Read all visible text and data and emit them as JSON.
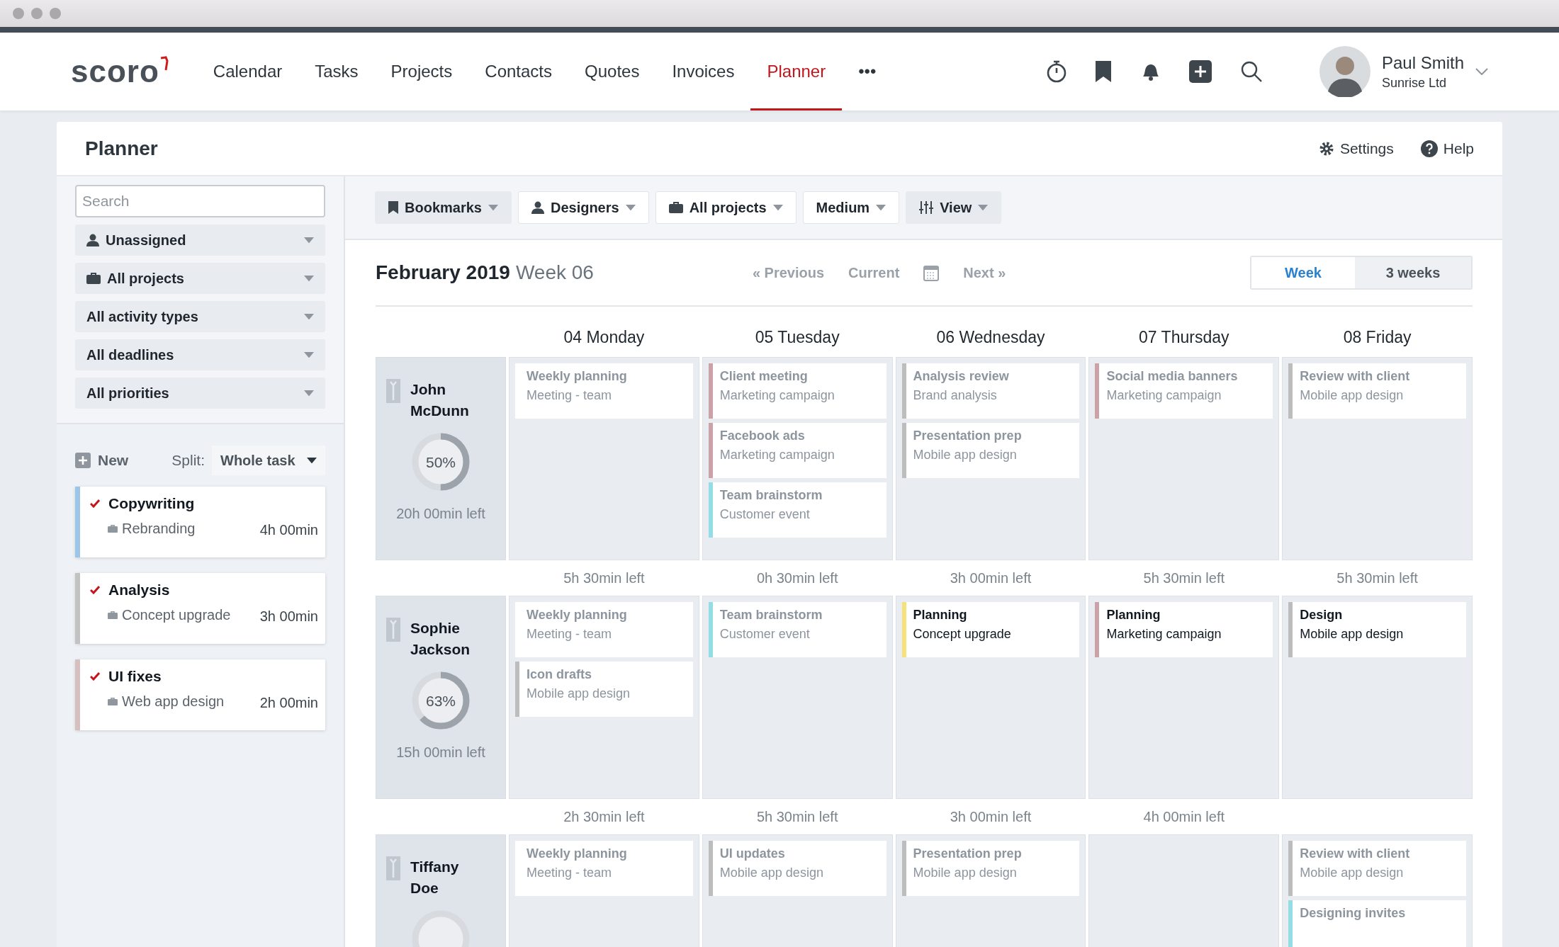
{
  "app": {
    "logo": "scoro"
  },
  "nav": [
    {
      "label": "Calendar",
      "selected": false
    },
    {
      "label": "Tasks",
      "selected": false
    },
    {
      "label": "Projects",
      "selected": false
    },
    {
      "label": "Contacts",
      "selected": false
    },
    {
      "label": "Quotes",
      "selected": false
    },
    {
      "label": "Invoices",
      "selected": false
    },
    {
      "label": "Planner",
      "selected": true
    },
    {
      "label": "•••",
      "selected": false
    }
  ],
  "user": {
    "name": "Paul Smith",
    "company": "Sunrise Ltd"
  },
  "page": {
    "title": "Planner",
    "settings": "Settings",
    "help": "Help"
  },
  "sidebar": {
    "search": {
      "placeholder": "Search"
    },
    "filters": [
      "Unassigned",
      "All projects",
      "All activity types",
      "All deadlines",
      "All priorities"
    ],
    "new_label": "New",
    "split_label": "Split:",
    "split_value": "Whole task",
    "tasks": [
      {
        "title": "Copywriting",
        "project": "Rebranding",
        "duration": "4h 00min",
        "checked": true,
        "color": "#9cc5e8"
      },
      {
        "title": "Analysis",
        "project": "Concept upgrade",
        "duration": "3h 00min",
        "checked": true,
        "color": "#c2c2c2"
      },
      {
        "title": "UI fixes",
        "project": "Web app design",
        "duration": "2h 00min",
        "checked": true,
        "color": "#d7bfc0"
      }
    ]
  },
  "toolbar": [
    {
      "label": "Bookmarks",
      "kind": "menu"
    },
    {
      "label": "Designers",
      "kind": "filter"
    },
    {
      "label": "All projects",
      "kind": "filter"
    },
    {
      "label": "Medium",
      "kind": "filter"
    },
    {
      "label": "View",
      "kind": "menu"
    }
  ],
  "period": {
    "month": "February 2019",
    "week": "Week 06",
    "previous": "« Previous",
    "current": "Current",
    "next": "Next »"
  },
  "views": [
    {
      "label": "Week",
      "selected": true
    },
    {
      "label": "3 weeks",
      "selected": false
    }
  ],
  "days": [
    "04 Monday",
    "05 Tuesday",
    "06 Wednesday",
    "07 Thursday",
    "08 Friday"
  ],
  "people": [
    {
      "name": "John McDunn",
      "percent": "50%",
      "level": 0.5,
      "left": "20h 00min left",
      "days": [
        {
          "remaining": "5h 30min left",
          "events": [
            {
              "title": "Weekly planning",
              "subtitle": "Meeting - team",
              "dimmed": true
            }
          ]
        },
        {
          "remaining": "0h 30min left",
          "events": [
            {
              "title": "Client meeting",
              "subtitle": "Marketing campaign",
              "dimmed": true,
              "color": "#cba2a8"
            },
            {
              "title": "Facebook ads",
              "subtitle": "Marketing campaign",
              "dimmed": true,
              "color": "#cba2a8"
            },
            {
              "title": "Team brainstorm",
              "subtitle": "Customer event",
              "dimmed": true,
              "color": "#94dde4"
            }
          ]
        },
        {
          "remaining": "3h 00min left",
          "events": [
            {
              "title": "Analysis review",
              "subtitle": "Brand analysis",
              "dimmed": true,
              "color": "#bdbdbd"
            },
            {
              "title": "Presentation prep",
              "subtitle": "Mobile app design",
              "dimmed": true,
              "color": "#bdbdbd"
            }
          ]
        },
        {
          "remaining": "5h 30min left",
          "events": [
            {
              "title": "Social media banners",
              "subtitle": "Marketing campaign",
              "dimmed": true,
              "color": "#cba2a8"
            }
          ]
        },
        {
          "remaining": "5h 30min left",
          "events": [
            {
              "title": "Review with client",
              "subtitle": "Mobile app design",
              "dimmed": true,
              "color": "#bdbdbd"
            }
          ]
        }
      ]
    },
    {
      "name": "Sophie Jackson",
      "percent": "63%",
      "level": 0.63,
      "left": "15h 00min left",
      "days": [
        {
          "remaining": "2h 30min left",
          "events": [
            {
              "title": "Weekly planning",
              "subtitle": "Meeting - team",
              "dimmed": true
            },
            {
              "title": "Icon drafts",
              "subtitle": "Mobile app design",
              "dimmed": true,
              "color": "#bdbdbd"
            }
          ]
        },
        {
          "remaining": "5h 30min left",
          "events": [
            {
              "title": "Team brainstorm",
              "subtitle": "Customer event",
              "dimmed": true,
              "color": "#94dde4"
            }
          ]
        },
        {
          "remaining": "3h 00min left",
          "events": [
            {
              "title": "Planning",
              "subtitle": "Concept upgrade",
              "dimmed": false,
              "color": "#f6e27a"
            }
          ]
        },
        {
          "remaining": "4h 00min left",
          "events": [
            {
              "title": "Planning",
              "subtitle": "Marketing campaign",
              "dimmed": false,
              "color": "#cba2a8"
            }
          ]
        },
        {
          "events": [
            {
              "title": "Design",
              "subtitle": "Mobile app design",
              "dimmed": false,
              "color": "#bdbdbd"
            }
          ]
        }
      ]
    },
    {
      "name": "Tiffany Doe",
      "days": [
        {
          "events": [
            {
              "title": "Weekly planning",
              "subtitle": "Meeting - team",
              "dimmed": true
            }
          ]
        },
        {
          "events": [
            {
              "title": "UI updates",
              "subtitle": "Mobile app design",
              "dimmed": true,
              "color": "#bdbdbd"
            }
          ]
        },
        {
          "events": [
            {
              "title": "Presentation prep",
              "subtitle": "Mobile app design",
              "dimmed": true,
              "color": "#bdbdbd"
            }
          ]
        },
        {
          "kind": "open"
        },
        {
          "events": [
            {
              "title": "Review with client",
              "subtitle": "Mobile app design",
              "dimmed": true,
              "color": "#bdbdbd"
            },
            {
              "title": "Designing invites",
              "dimmed": true,
              "color": "#94dde4"
            }
          ]
        }
      ]
    }
  ]
}
